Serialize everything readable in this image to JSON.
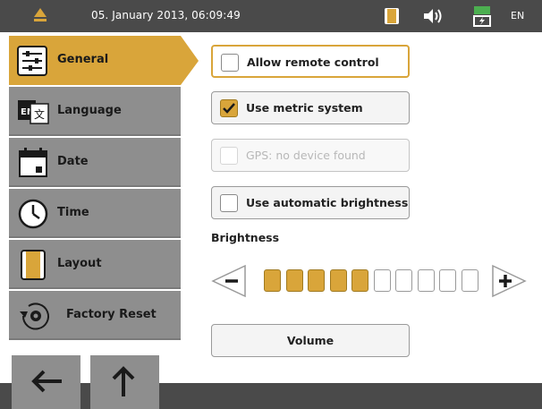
{
  "status_bar": {
    "datetime": "05. January 2013, 06:09:49",
    "language": "EN",
    "icons": [
      "logo-icon",
      "layout-icon",
      "speaker-icon",
      "battery-charging-icon"
    ]
  },
  "sidebar": {
    "items": [
      {
        "label": "General",
        "icon": "sliders-icon",
        "active": true
      },
      {
        "label": "Language",
        "icon": "language-icon",
        "active": false
      },
      {
        "label": "Date",
        "icon": "calendar-icon",
        "active": false
      },
      {
        "label": "Time",
        "icon": "clock-icon",
        "active": false
      },
      {
        "label": "Layout",
        "icon": "layout-icon",
        "active": false
      },
      {
        "label": "Factory Reset",
        "icon": "factory-reset-icon",
        "active": false
      }
    ]
  },
  "bottom_nav": {
    "back_icon": "arrow-left-icon",
    "up_icon": "arrow-up-icon"
  },
  "settings": {
    "options": [
      {
        "label": "Allow remote control",
        "checked": false,
        "enabled": true,
        "highlighted": true
      },
      {
        "label": "Use metric system",
        "checked": true,
        "enabled": true,
        "highlighted": false
      },
      {
        "label": "GPS: no device found",
        "checked": false,
        "enabled": false,
        "highlighted": false
      },
      {
        "label": "Use automatic brightness",
        "checked": false,
        "enabled": true,
        "highlighted": false
      }
    ],
    "brightness_title": "Brightness",
    "brightness_level": 5,
    "brightness_max": 10,
    "volume_label": "Volume"
  },
  "colors": {
    "accent": "#d9a53a",
    "bar": "#4a4a4a",
    "nav": "#8e8e8e"
  }
}
